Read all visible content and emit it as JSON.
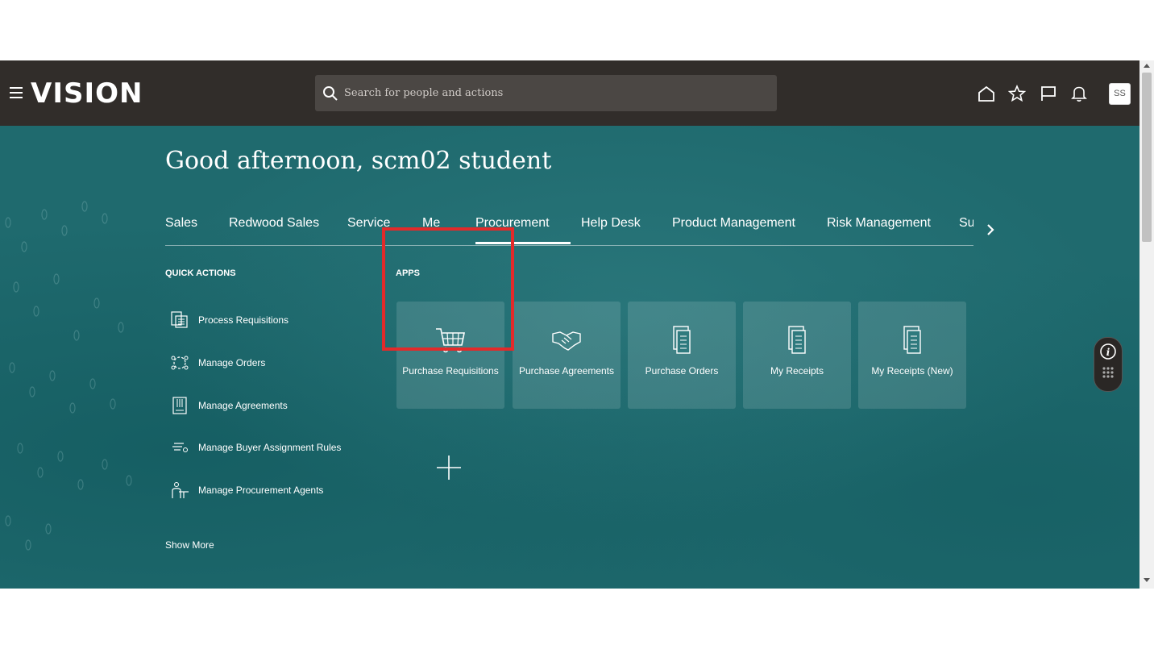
{
  "header": {
    "logo": "VISION",
    "search_placeholder": "Search for people and actions",
    "avatar_initials": "SS"
  },
  "greeting": "Good afternoon, scm02 student",
  "tabs": [
    {
      "label": "Sales"
    },
    {
      "label": "Redwood Sales"
    },
    {
      "label": "Service"
    },
    {
      "label": "Me"
    },
    {
      "label": "Procurement",
      "active": true
    },
    {
      "label": "Help Desk"
    },
    {
      "label": "Product Management"
    },
    {
      "label": "Risk Management"
    },
    {
      "label": "Su"
    }
  ],
  "quick_actions": {
    "title": "QUICK ACTIONS",
    "items": [
      {
        "label": "Process Requisitions",
        "icon": "process-requisitions-icon"
      },
      {
        "label": "Manage Orders",
        "icon": "manage-orders-icon"
      },
      {
        "label": "Manage Agreements",
        "icon": "manage-agreements-icon"
      },
      {
        "label": "Manage Buyer Assignment Rules",
        "icon": "buyer-rules-icon"
      },
      {
        "label": "Manage Procurement Agents",
        "icon": "procurement-agents-icon"
      }
    ],
    "show_more": "Show More"
  },
  "apps": {
    "title": "APPS",
    "tiles": [
      {
        "label": "Purchase Requisitions",
        "icon": "cart-icon",
        "highlighted": true
      },
      {
        "label": "Purchase Agreements",
        "icon": "handshake-icon"
      },
      {
        "label": "Purchase Orders",
        "icon": "document-icon"
      },
      {
        "label": "My Receipts",
        "icon": "document-icon"
      },
      {
        "label": "My Receipts (New)",
        "icon": "document-icon"
      }
    ]
  },
  "colors": {
    "header_bg": "#312d2a",
    "hero_bg": "#1f6a6e",
    "highlight": "#e32a2a"
  }
}
